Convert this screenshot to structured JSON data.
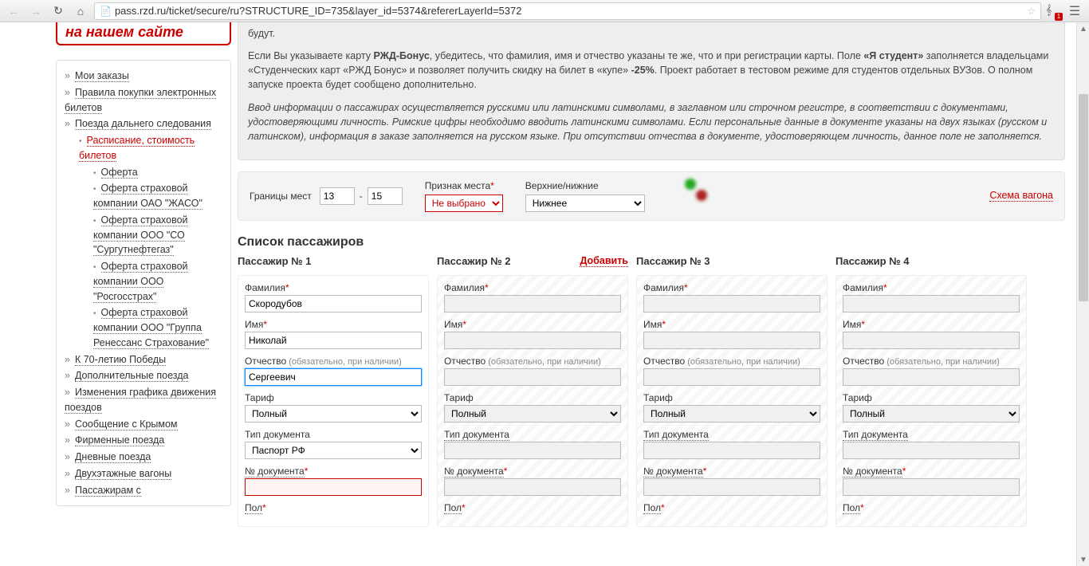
{
  "url": "pass.rzd.ru/ticket/secure/ru?STRUCTURE_ID=735&layer_id=5374&refererLayerId=5372",
  "promo_header": "на нашем сайте",
  "sidebar": {
    "items": [
      {
        "label": "Мои заказы",
        "level": 1
      },
      {
        "label": "Правила покупки электронных билетов",
        "level": 1
      },
      {
        "label": "Поезда дальнего следования",
        "level": 1
      },
      {
        "label": "Расписание, стоимость билетов",
        "level": 2,
        "red": true
      },
      {
        "label": "Оферта",
        "level": 3
      },
      {
        "label": "Оферта страховой компании ОАО \"ЖАСО\"",
        "level": 3
      },
      {
        "label": "Оферта страховой компании ООО \"СО \"Сургутнефтегаз\"",
        "level": 3
      },
      {
        "label": "Оферта страховой компании ООО \"Росгосстрах\"",
        "level": 3
      },
      {
        "label": "Оферта страховой компании ООО \"Группа Ренессанс Страхование\"",
        "level": 3
      },
      {
        "label": "К 70-летию Победы",
        "level": 1
      },
      {
        "label": "Дополнительные поезда",
        "level": 1
      },
      {
        "label": "Изменения графика движения поездов",
        "level": 1
      },
      {
        "label": "Сообщение с Крымом",
        "level": 1
      },
      {
        "label": "Фирменные поезда",
        "level": 1
      },
      {
        "label": "Дневные поезда",
        "level": 1
      },
      {
        "label": "Двухэтажные вагоны",
        "level": 1
      },
      {
        "label": "Пассажирам с",
        "level": 1
      }
    ]
  },
  "info": {
    "line1_tail": "будут.",
    "p2_a": "Если Вы указываете карту ",
    "p2_b": "РЖД-Бонус",
    "p2_c": ", убедитесь, что фамилия, имя и отчество указаны те же, что и при регистрации карты. Поле ",
    "p2_d": "«Я студент»",
    "p2_e": " заполняется владельцами «Студенческих карт «РЖД Бонус» и позволяет получить скидку на билет в «купе» ",
    "p2_f": "-25%",
    "p2_g": ". Проект работает в тестовом режиме для студентов отдельных ВУЗов. О полном запуске проекта будет сообщено дополнительно.",
    "p3": "Ввод информации о пассажирах осуществляется русскими или латинскими символами, в заглавном или строчном регистре, в соответствии с документами, удостоверяющими личность. Римские цифры необходимо вводить латинскими символами. Если персональные данные в документе указаны на двух языках (русском и латинском), информация в заказе заполняется на русском языке. При отсутствии отчества в документе, удостоверяющем личность, данное поле не заполняется."
  },
  "seatbar": {
    "bounds_label": "Границы мест",
    "from": "13",
    "to": "15",
    "sign_label": "Признак места",
    "sign_value": "Не выбрано",
    "updown_label": "Верхние/нижние",
    "updown_value": "Нижнее",
    "scheme": "Схема вагона"
  },
  "pax_title": "Список пассажиров",
  "add_label": "Добавить",
  "field_labels": {
    "surname": "Фамилия",
    "name": "Имя",
    "patronymic": "Отчество",
    "patronymic_hint": "(обязательно, при наличии)",
    "tariff": "Тариф",
    "doc_type": "Тип документа",
    "doc_no": "№ документа",
    "gender": "Пол"
  },
  "tariff_default": "Полный",
  "doc_default": "Паспорт РФ",
  "passengers": [
    {
      "title": "Пассажир № 1",
      "enabled": true,
      "surname": "Скородубов",
      "name": "Николай",
      "patronymic": "Сергеевич",
      "doc_no": ""
    },
    {
      "title": "Пассажир № 2",
      "enabled": false,
      "surname": "",
      "name": "",
      "patronymic": "",
      "doc_no": ""
    },
    {
      "title": "Пассажир № 3",
      "enabled": false,
      "surname": "",
      "name": "",
      "patronymic": "",
      "doc_no": ""
    },
    {
      "title": "Пассажир № 4",
      "enabled": false,
      "surname": "",
      "name": "",
      "patronymic": "",
      "doc_no": ""
    }
  ]
}
